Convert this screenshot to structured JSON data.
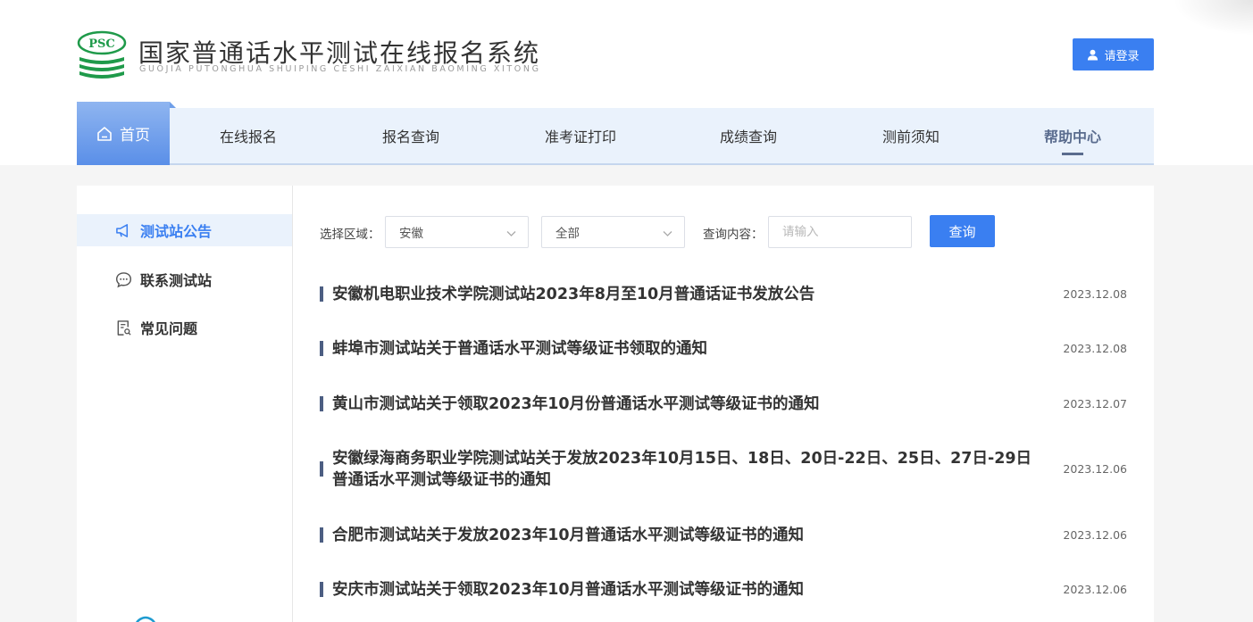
{
  "header": {
    "logo_text": "PSC",
    "title": "国家普通话水平测试在线报名系统",
    "subtitle": "GUOJIA PUTONGHUA SHUIPING CESHI ZAIXIAN BAOMING XITONG",
    "login_label": "请登录"
  },
  "nav": {
    "home_label": "首页",
    "items": [
      "在线报名",
      "报名查询",
      "准考证打印",
      "成绩查询",
      "测前须知",
      "帮助中心"
    ],
    "active_item": "帮助中心"
  },
  "sidebar": {
    "items": [
      {
        "label": "测试站公告",
        "icon": "megaphone-icon",
        "active": true
      },
      {
        "label": "联系测试站",
        "icon": "chat-bubble-icon",
        "active": false
      },
      {
        "label": "常见问题",
        "icon": "document-search-icon",
        "active": false
      }
    ]
  },
  "filter": {
    "region_label": "选择区域：",
    "region_value": "安徽",
    "sub_region_value": "全部",
    "query_label": "查询内容：",
    "query_placeholder": "请输入",
    "query_button": "查询"
  },
  "news": [
    {
      "title": "安徽机电职业技术学院测试站2023年8月至10月普通话证书发放公告",
      "date": "2023.12.08"
    },
    {
      "title": "蚌埠市测试站关于普通话水平测试等级证书领取的通知",
      "date": "2023.12.08"
    },
    {
      "title": "黄山市测试站关于领取2023年10月份普通话水平测试等级证书的通知",
      "date": "2023.12.07"
    },
    {
      "title_line1": "安徽绿海商务职业学院测试站关于发放2023年10月15日、18日、20日-22日、25日、27日-29日",
      "title_line2": "普通话水平测试等级证书的通知",
      "date": "2023.12.06"
    },
    {
      "title": "合肥市测试站关于发放2023年10月普通话水平测试等级证书的通知",
      "date": "2023.12.06"
    },
    {
      "title": "安庆市测试站关于领取2023年10月普通话水平测试等级证书的通知",
      "date": "2023.12.06"
    }
  ],
  "colors": {
    "accent": "#3a7ff1",
    "nav_bg": "#eaf2fc",
    "logo_green": "#1f9a4a",
    "bar": "#4c5e82"
  }
}
